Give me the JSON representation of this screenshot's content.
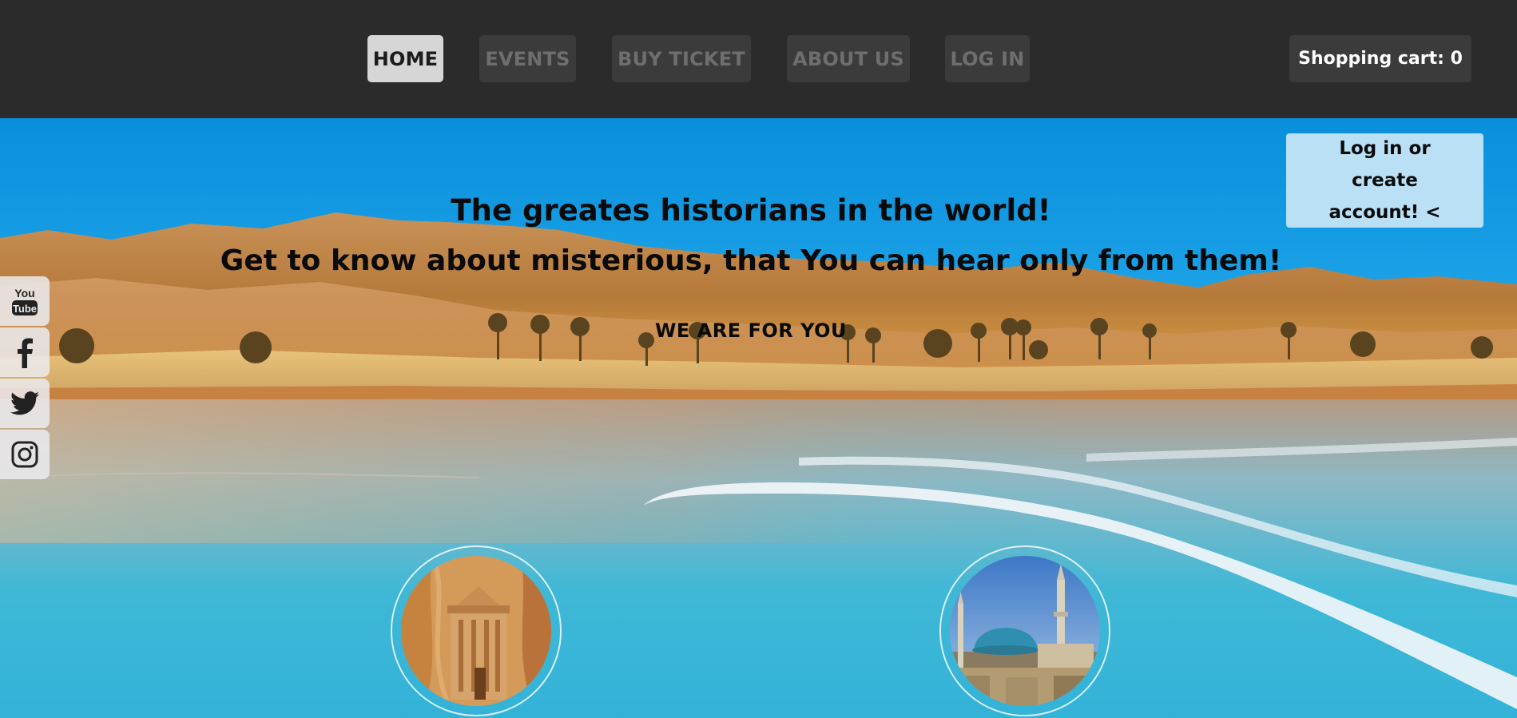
{
  "nav": {
    "items": [
      {
        "label": "HOME",
        "active": true
      },
      {
        "label": "EVENTS",
        "active": false
      },
      {
        "label": "BUY TICKET",
        "active": false
      },
      {
        "label": "ABOUT US",
        "active": false
      },
      {
        "label": "LOG IN",
        "active": false
      }
    ],
    "cart_label": "Shopping cart: 0"
  },
  "hero": {
    "title": "The greates historians in the world!",
    "tagline": "Get to know about misterious, that You can hear only from them!",
    "subtitle": "WE ARE FOR YOU",
    "login_card": "Log in or create account! <"
  },
  "social": {
    "youtube_top": "You",
    "youtube_bottom": "Tube",
    "icons": [
      "youtube-icon",
      "facebook-icon",
      "twitter-icon",
      "instagram-icon"
    ]
  },
  "colors": {
    "topbar": "#2b2b2b",
    "nav_active_bg": "#d6d6d6",
    "nav_inactive_bg": "#3b3b3b",
    "nav_inactive_text": "#6e6e6e",
    "login_card_bg": "#b9e0f4",
    "sky": "#0d93dc",
    "water": "#3fb8d6"
  }
}
